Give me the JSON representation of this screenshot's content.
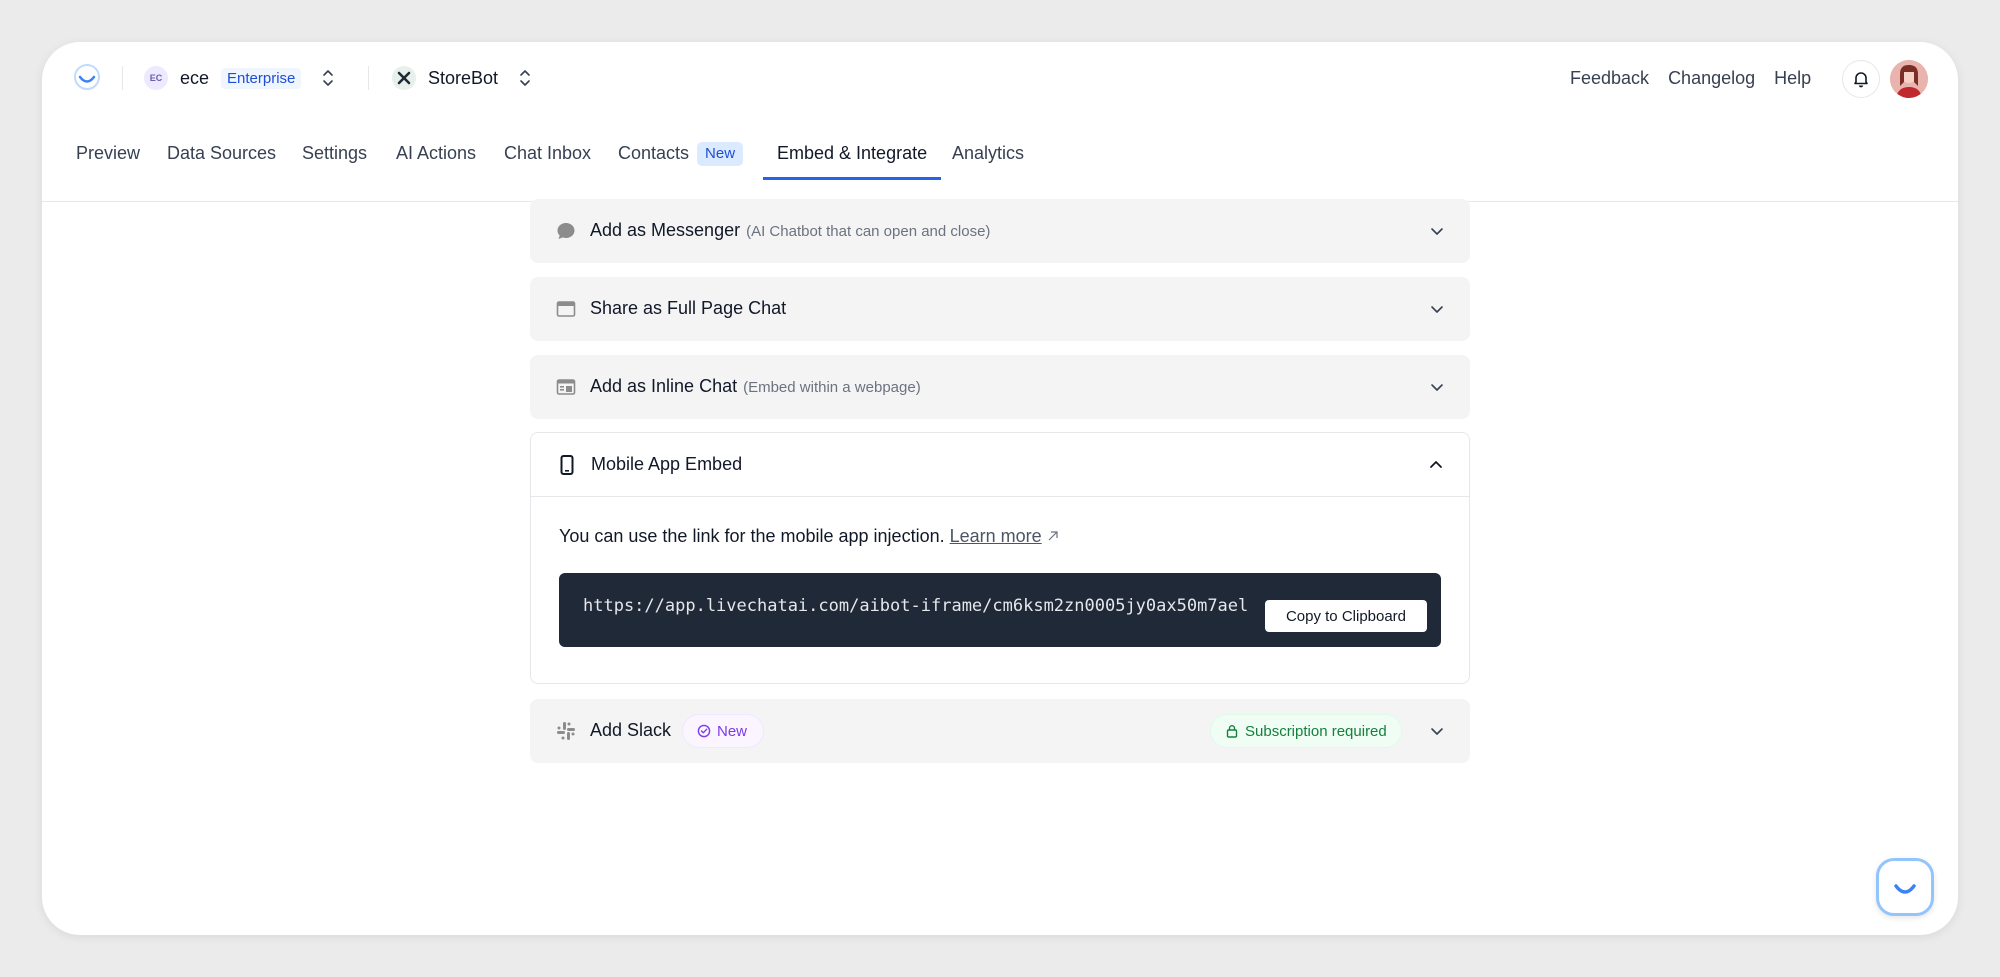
{
  "header": {
    "org": {
      "initials": "EC",
      "name": "ece",
      "plan": "Enterprise"
    },
    "bot": {
      "name": "StoreBot"
    },
    "links": [
      "Feedback",
      "Changelog",
      "Help"
    ]
  },
  "tabs": [
    {
      "label": "Preview"
    },
    {
      "label": "Data Sources"
    },
    {
      "label": "Settings"
    },
    {
      "label": "AI Actions"
    },
    {
      "label": "Chat Inbox"
    },
    {
      "label": "Contacts",
      "badge": "New"
    },
    {
      "label": "Embed & Integrate",
      "active": true
    },
    {
      "label": "Analytics"
    }
  ],
  "sections": {
    "messenger": {
      "title": "Add as Messenger",
      "subtitle": "(AI Chatbot that can open and close)"
    },
    "fullpage": {
      "title": "Share as Full Page Chat"
    },
    "inline": {
      "title": "Add as Inline Chat",
      "subtitle": "(Embed within a webpage)"
    },
    "mobile": {
      "title": "Mobile App Embed",
      "description": "You can use the link for the mobile app injection.",
      "learn_more": "Learn more",
      "url": "https://app.livechatai.com/aibot-iframe/cm6ksm2zn0005jy0ax50m7ael",
      "copy_label": "Copy to Clipboard"
    },
    "slack": {
      "title": "Add Slack",
      "badge": "New",
      "subscription": "Subscription required"
    }
  },
  "colors": {
    "accent": "#2563eb",
    "code_bg": "#1f2937",
    "subscription_green": "#15803d",
    "new_purple": "#7c3aed"
  },
  "icons": [
    "logo-icon",
    "chevron-up-down-icon",
    "close-x-icon",
    "bell-icon",
    "chat-bubble-icon",
    "window-icon",
    "inline-embed-icon",
    "phone-icon",
    "slack-icon",
    "badge-check-icon",
    "lock-icon",
    "chevron-down-icon",
    "chevron-up-icon",
    "external-arrow-icon"
  ]
}
